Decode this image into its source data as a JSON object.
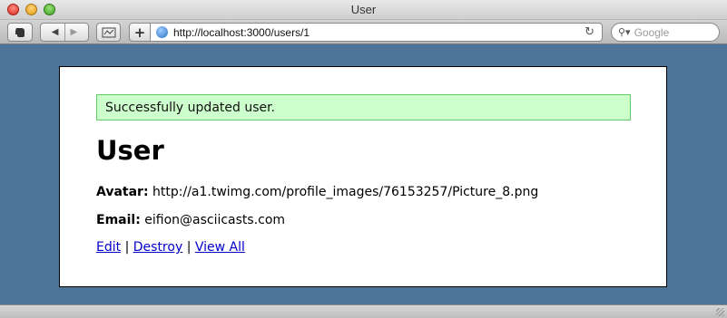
{
  "window": {
    "title": "User"
  },
  "toolbar": {
    "back_icon": "back-arrow-icon",
    "forward_icon": "forward-arrow-icon",
    "address_url": "http://localhost:3000/users/1",
    "search_placeholder": "Google"
  },
  "page": {
    "flash_notice": "Successfully updated user.",
    "heading": "User",
    "avatar_label": "Avatar:",
    "avatar_value": "http://a1.twimg.com/profile_images/76153257/Picture_8.png",
    "email_label": "Email:",
    "email_value": "eifion@asciicasts.com",
    "links": [
      {
        "label": "Edit"
      },
      {
        "label": "Destroy"
      },
      {
        "label": "View All"
      }
    ],
    "separator": "|"
  },
  "colors": {
    "page_background": "#4d7399",
    "flash_background": "#ccffcc",
    "flash_border": "#66cc66",
    "link": "#0000cc"
  }
}
